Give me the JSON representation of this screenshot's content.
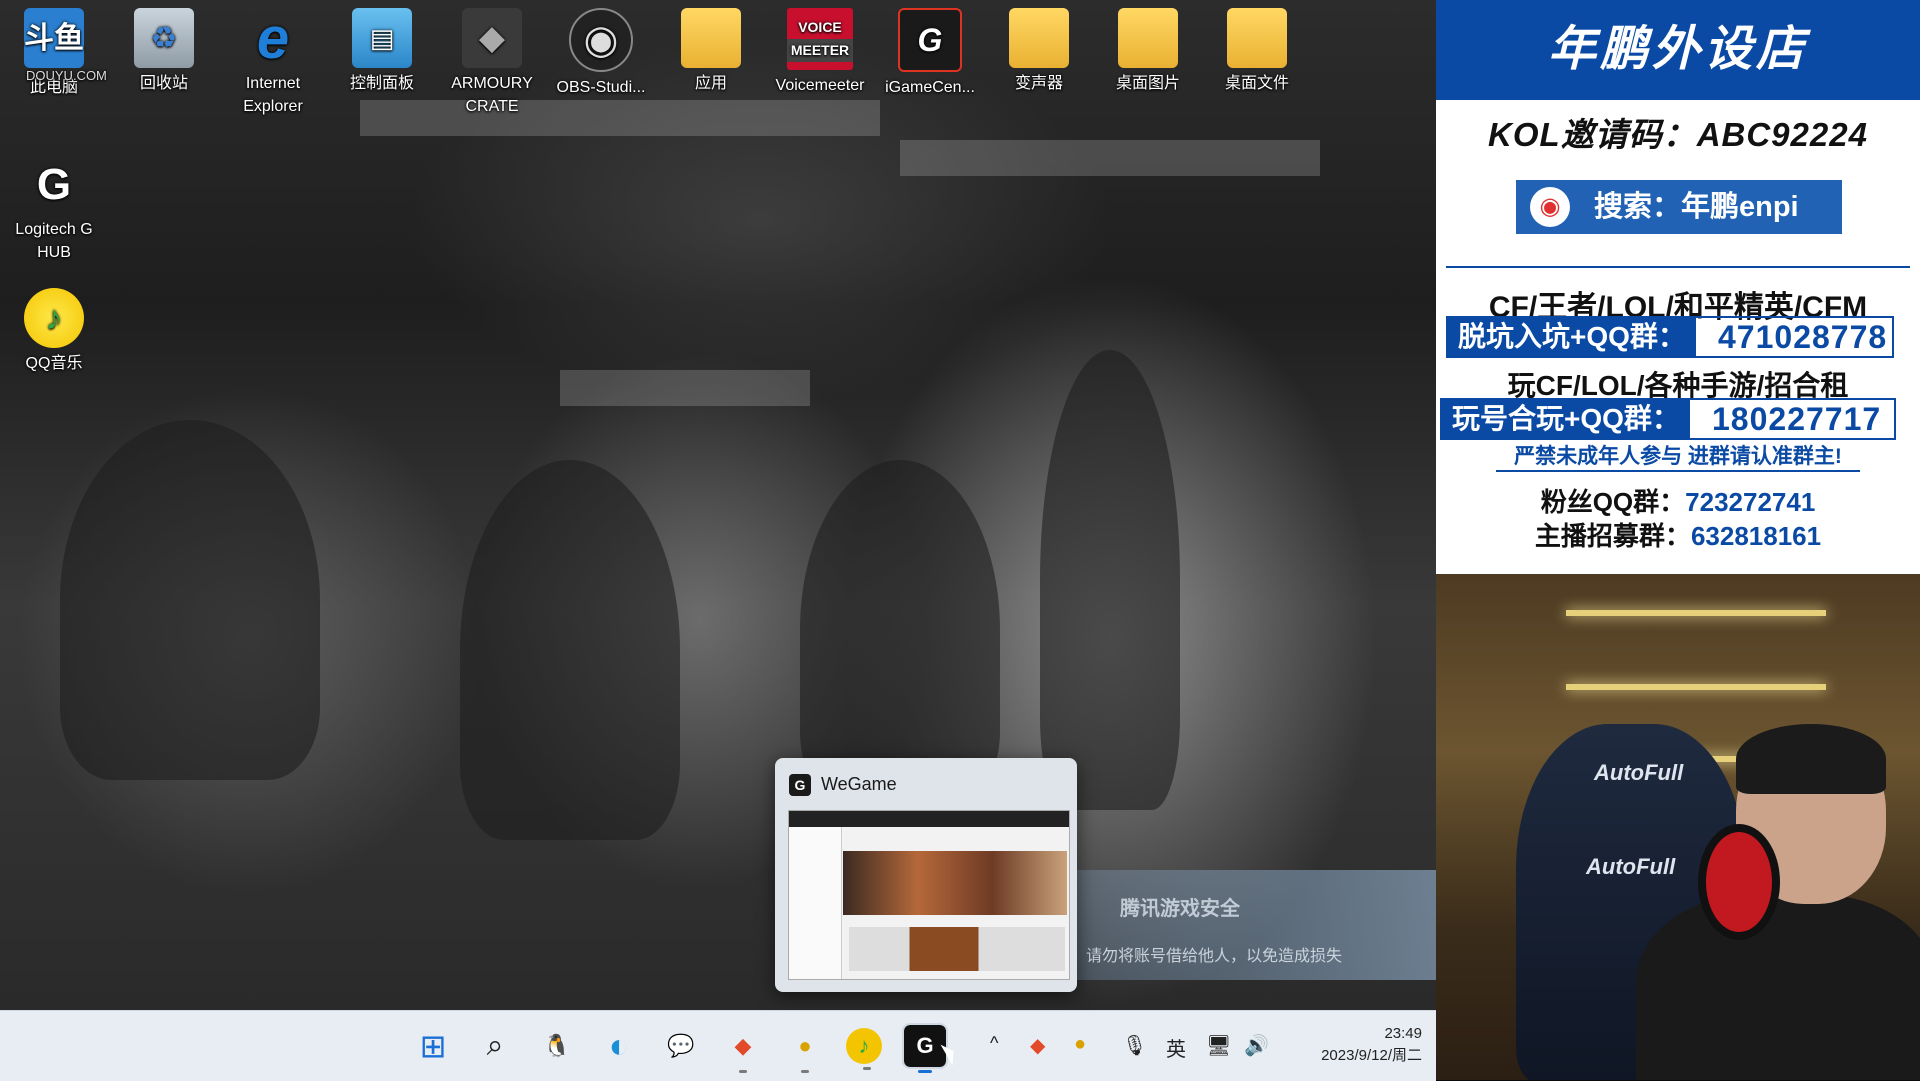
{
  "desktop": {
    "icons_row": [
      {
        "label": "此电脑",
        "icon": "computer-icon"
      },
      {
        "label": "回收站",
        "icon": "recycle-bin-icon"
      },
      {
        "label": "Internet Explorer",
        "icon": "internet-explorer-icon"
      },
      {
        "label": "控制面板",
        "icon": "control-panel-icon"
      },
      {
        "label": "ARMOURY CRATE",
        "icon": "armoury-crate-icon"
      },
      {
        "label": "OBS-Studi...",
        "icon": "obs-icon"
      },
      {
        "label": "应用",
        "icon": "folder-icon"
      },
      {
        "label": "Voicemeeter",
        "icon": "voicemeeter-icon"
      },
      {
        "label": "iGameCen...",
        "icon": "igamecenter-icon"
      },
      {
        "label": "变声器",
        "icon": "folder-icon"
      },
      {
        "label": "桌面图片",
        "icon": "folder-icon"
      },
      {
        "label": "桌面文件",
        "icon": "folder-icon"
      }
    ],
    "icons_col": [
      {
        "label": "Logitech G HUB",
        "icon": "logitech-g-hub-icon"
      },
      {
        "label": "QQ音乐",
        "icon": "qq-music-icon"
      }
    ],
    "watermark": {
      "line1": "斗鱼",
      "line2": "DOUYU.COM"
    },
    "voicemeeter_top": "VOICE",
    "voicemeeter_bottom": "MEETER"
  },
  "popup": {
    "title": "WeGame"
  },
  "security_notice": {
    "heading": "腾讯游戏安全",
    "message": "请勿将账号借给他人，以免造成损失"
  },
  "taskbar": {
    "apps": [
      {
        "name": "start-button",
        "glyph": "⊞"
      },
      {
        "name": "search-button",
        "glyph": "⌕"
      },
      {
        "name": "qq-taskbar",
        "glyph": "🐧"
      },
      {
        "name": "edge-taskbar",
        "glyph": "◐"
      },
      {
        "name": "wechat-taskbar",
        "glyph": "💬"
      },
      {
        "name": "app-red-taskbar",
        "glyph": "◆"
      },
      {
        "name": "app-yellow-taskbar",
        "glyph": "●"
      },
      {
        "name": "qq-music-taskbar",
        "glyph": "♪"
      },
      {
        "name": "wegame-taskbar",
        "glyph": "G"
      }
    ],
    "tray": {
      "chevron": "^",
      "ime": "英",
      "mic": "🎙",
      "network": "🖥",
      "volume": "🔊"
    },
    "clock": {
      "time": "23:49",
      "date": "2023/9/12/周二"
    }
  },
  "panel": {
    "shop_title": "年鹏外设店",
    "kol_line": "KOL邀请码：ABC92224",
    "weibo_search": "搜索：年鹏enpi",
    "games_line": "CF/王者/LOL/和平精英/CFM",
    "group1_label": "脱坑入坑+QQ群：",
    "group1_number": "471028778",
    "play_line": "玩CF/LOL/各种手游/招合租",
    "group2_label": "玩号合玩+QQ群：",
    "group2_number": "180227717",
    "warning": "严禁未成年人参与  进群请认准群主!",
    "fans_label": "粉丝QQ群：",
    "fans_number": "723272741",
    "recruit_label": "主播招募群：",
    "recruit_number": "632818161",
    "cam_brand": "AutoFull"
  },
  "colors": {
    "accent_blue": "#0a4aa5",
    "taskbar_bg": "#e8edf3"
  }
}
